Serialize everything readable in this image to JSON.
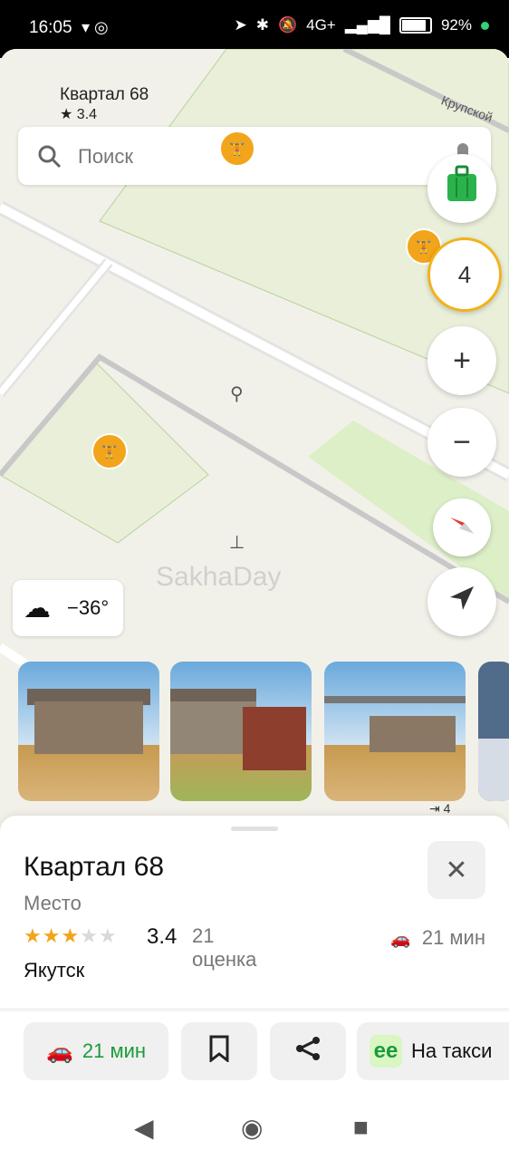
{
  "status_bar": {
    "time": "16:05",
    "battery": "92%",
    "network": "4G+"
  },
  "map": {
    "top_place": {
      "name": "Квартал 68",
      "rating": "★ 3.4"
    },
    "street_label": "Крупской",
    "search": {
      "placeholder": "Поиск"
    },
    "controls": {
      "layers_count": "4"
    },
    "weather": {
      "temp": "−36°"
    },
    "watermark": "SakhaDay",
    "photo_count": "4"
  },
  "place_card": {
    "title": "Квартал 68",
    "subtitle": "Место",
    "rating": "3.4",
    "rating_count": "21 оценка",
    "eta": "21 мин",
    "city": "Якутск",
    "stars": [
      1,
      1,
      1,
      0,
      0
    ]
  },
  "actions": {
    "route_eta": "21 мин",
    "taxi_label": "На такси"
  },
  "icons": {
    "search": "search-icon",
    "mic": "mic-icon",
    "bag": "bag-icon",
    "plus": "plus-icon",
    "minus": "minus-icon",
    "compass": "compass-icon",
    "locate": "locate-icon",
    "close": "close-icon",
    "car": "car-icon",
    "bookmark": "bookmark-icon",
    "share": "share-icon",
    "taxi": "taxi-icon"
  },
  "colors": {
    "poi": "#f2a41b",
    "green": "#1a9b3a",
    "stars": "#f2a41b"
  }
}
